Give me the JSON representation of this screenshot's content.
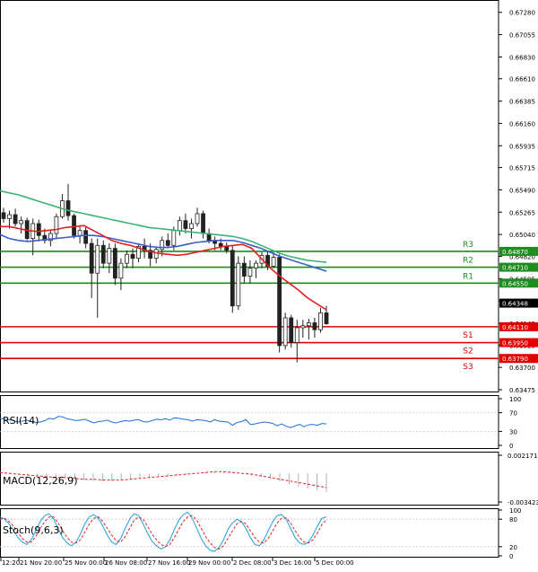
{
  "colors": {
    "bull": "#2e7d32",
    "bear": "#d32f2f",
    "resistance": "#1e8c1e",
    "support": "#e00000",
    "ema_fast": "#e02020",
    "ema_mid": "#3a5fcd",
    "ema_slow": "#3cb371",
    "rsi": "#1e6fd9",
    "macd_hist": "#b0b0b0",
    "macd_signal": "#e02020",
    "stoch_k": "#1ea0e0",
    "stoch_d": "#e02020",
    "current_price_box": "#000000"
  },
  "chart_data": [
    {
      "type": "candlestick",
      "x_labels": [
        "12:20",
        "21 Nov 20:00",
        "25 Nov 00:00",
        "26 Nov 08:00",
        "27 Nov 16:00",
        "29 Nov 00:00",
        "2 Dec 08:00",
        "3 Dec 16:00",
        "5 Dec 00:00"
      ],
      "y_ticks": [
        "0.67280",
        "0.67055",
        "0.66830",
        "0.66610",
        "0.66385",
        "0.66160",
        "0.65935",
        "0.65715",
        "0.65490",
        "0.65265",
        "0.65040",
        "0.64820",
        "0.64595",
        "0.64370",
        "0.64145",
        "0.63925",
        "0.63700",
        "0.63475"
      ],
      "ylim": [
        0.63475,
        0.6735
      ],
      "candles": [
        [
          0.6526,
          0.6531,
          0.6516,
          0.652
        ],
        [
          0.652,
          0.6528,
          0.651,
          0.6524
        ],
        [
          0.6524,
          0.653,
          0.6512,
          0.6515
        ],
        [
          0.6515,
          0.6522,
          0.6505,
          0.6518
        ],
        [
          0.6518,
          0.6521,
          0.6498,
          0.65
        ],
        [
          0.65,
          0.652,
          0.6483,
          0.6515
        ],
        [
          0.6515,
          0.6519,
          0.6497,
          0.6503
        ],
        [
          0.6503,
          0.651,
          0.6495,
          0.6498
        ],
        [
          0.6498,
          0.6508,
          0.6492,
          0.6505
        ],
        [
          0.6505,
          0.6525,
          0.65,
          0.6522
        ],
        [
          0.6522,
          0.6545,
          0.652,
          0.6538
        ],
        [
          0.6538,
          0.6555,
          0.6518,
          0.6523
        ],
        [
          0.6523,
          0.6525,
          0.65,
          0.6503
        ],
        [
          0.6503,
          0.6512,
          0.6495,
          0.6508
        ],
        [
          0.6508,
          0.6512,
          0.649,
          0.6495
        ],
        [
          0.6495,
          0.65,
          0.644,
          0.6465
        ],
        [
          0.6465,
          0.65,
          0.642,
          0.6493
        ],
        [
          0.6493,
          0.6498,
          0.647,
          0.6475
        ],
        [
          0.6475,
          0.6495,
          0.6465,
          0.649
        ],
        [
          0.649,
          0.6495,
          0.6453,
          0.646
        ],
        [
          0.646,
          0.648,
          0.6448,
          0.6475
        ],
        [
          0.6475,
          0.6488,
          0.647,
          0.6484
        ],
        [
          0.6484,
          0.649,
          0.647,
          0.648
        ],
        [
          0.648,
          0.6495,
          0.6476,
          0.6492
        ],
        [
          0.6492,
          0.65,
          0.648,
          0.6488
        ],
        [
          0.6488,
          0.6495,
          0.6472,
          0.648
        ],
        [
          0.648,
          0.6492,
          0.6475,
          0.6489
        ],
        [
          0.6489,
          0.6502,
          0.6482,
          0.6498
        ],
        [
          0.6498,
          0.6505,
          0.649,
          0.6493
        ],
        [
          0.6493,
          0.6512,
          0.6488,
          0.6508
        ],
        [
          0.6508,
          0.6522,
          0.6503,
          0.6518
        ],
        [
          0.6518,
          0.6525,
          0.6505,
          0.651
        ],
        [
          0.651,
          0.652,
          0.65,
          0.6515
        ],
        [
          0.6515,
          0.6531,
          0.6512,
          0.6525
        ],
        [
          0.6525,
          0.6528,
          0.65,
          0.6505
        ],
        [
          0.6505,
          0.651,
          0.6495,
          0.6498
        ],
        [
          0.6498,
          0.6502,
          0.6488,
          0.6495
        ],
        [
          0.6495,
          0.65,
          0.6488,
          0.6492
        ],
        [
          0.6492,
          0.6496,
          0.6485,
          0.6488
        ],
        [
          0.6488,
          0.6493,
          0.6425,
          0.6432
        ],
        [
          0.6432,
          0.6482,
          0.6428,
          0.6475
        ],
        [
          0.6475,
          0.6482,
          0.6455,
          0.6462
        ],
        [
          0.6462,
          0.6478,
          0.6455,
          0.647
        ],
        [
          0.647,
          0.6478,
          0.646,
          0.6475
        ],
        [
          0.6475,
          0.6486,
          0.647,
          0.6483
        ],
        [
          0.6483,
          0.6487,
          0.6468,
          0.6472
        ],
        [
          0.6472,
          0.6486,
          0.647,
          0.6481
        ],
        [
          0.6481,
          0.6484,
          0.6385,
          0.6392
        ],
        [
          0.6392,
          0.6425,
          0.6388,
          0.642
        ],
        [
          0.642,
          0.6423,
          0.639,
          0.6395
        ],
        [
          0.6395,
          0.6418,
          0.6375,
          0.641
        ],
        [
          0.641,
          0.6418,
          0.64,
          0.6412
        ],
        [
          0.6412,
          0.6419,
          0.6398,
          0.6415
        ],
        [
          0.6415,
          0.642,
          0.64,
          0.6408
        ],
        [
          0.6408,
          0.643,
          0.6405,
          0.6425
        ],
        [
          0.6425,
          0.6432,
          0.6413,
          0.6414
        ]
      ],
      "ema_fast": [
        0.6512,
        0.6512,
        0.651,
        0.6508,
        0.6507,
        0.6508,
        0.6509,
        0.6511,
        0.6512,
        0.6513,
        0.6508,
        0.6503,
        0.6498,
        0.6495,
        0.6493,
        0.649,
        0.6487,
        0.6485,
        0.6484,
        0.6483,
        0.6484,
        0.6486,
        0.6488,
        0.649,
        0.6492,
        0.6493,
        0.6494,
        0.649,
        0.648,
        0.647,
        0.6462,
        0.6455,
        0.6448,
        0.644,
        0.6434,
        0.6428
      ],
      "ema_mid": [
        0.6504,
        0.65,
        0.6498,
        0.6497,
        0.6498,
        0.6499,
        0.65,
        0.6501,
        0.6502,
        0.6503,
        0.6503,
        0.6502,
        0.65,
        0.6498,
        0.6496,
        0.6494,
        0.6492,
        0.6491,
        0.6491,
        0.6492,
        0.6494,
        0.6496,
        0.6497,
        0.6498,
        0.6498,
        0.6498,
        0.6496,
        0.6493,
        0.649,
        0.6486,
        0.6482,
        0.6479,
        0.6476,
        0.6473,
        0.647,
        0.6467
      ],
      "ema_slow": [
        0.6548,
        0.6546,
        0.6544,
        0.6541,
        0.6538,
        0.6535,
        0.6532,
        0.6529,
        0.6527,
        0.6525,
        0.6523,
        0.6521,
        0.6519,
        0.6517,
        0.6515,
        0.6513,
        0.6511,
        0.651,
        0.6509,
        0.6508,
        0.6507,
        0.6506,
        0.6505,
        0.6504,
        0.6503,
        0.6502,
        0.65,
        0.6497,
        0.6493,
        0.6489,
        0.6485,
        0.6482,
        0.648,
        0.6478,
        0.6477,
        0.6476
      ],
      "levels": [
        {
          "name": "R3",
          "value": 0.6487,
          "price_label": "0.64870",
          "kind": "resistance"
        },
        {
          "name": "R2",
          "value": 0.6471,
          "price_label": "0.64710",
          "kind": "resistance"
        },
        {
          "name": "R1",
          "value": 0.6455,
          "price_label": "0.64550",
          "kind": "resistance"
        },
        {
          "name": "S1",
          "value": 0.6411,
          "price_label": "0.64110",
          "kind": "support"
        },
        {
          "name": "S2",
          "value": 0.6395,
          "price_label": "0.63950",
          "kind": "support"
        },
        {
          "name": "S3",
          "value": 0.6379,
          "price_label": "0.63790",
          "kind": "support"
        }
      ],
      "current_price": {
        "value": 0.64348,
        "label": "0.64348"
      }
    },
    {
      "type": "line",
      "title": "RSI(14)",
      "y_ticks": [
        "100",
        "70",
        "30",
        "0"
      ],
      "ylim": [
        0,
        100
      ],
      "values": [
        58,
        56,
        55,
        53,
        50,
        52,
        54,
        51,
        49,
        50,
        53,
        58,
        56,
        62,
        61,
        57,
        55,
        53,
        54,
        56,
        52,
        48,
        51,
        52,
        54,
        50,
        48,
        51,
        53,
        52,
        54,
        55,
        51,
        50,
        53,
        56,
        55,
        57,
        54,
        59,
        58,
        56,
        55,
        52,
        55,
        54,
        53,
        50,
        55,
        52,
        51,
        50,
        43,
        49,
        51,
        55,
        45,
        46,
        48,
        50,
        49,
        47,
        42,
        46,
        41,
        38,
        42,
        45,
        40,
        44,
        45,
        43,
        47,
        46
      ]
    },
    {
      "type": "bar",
      "title": "MACD(12,26,9)",
      "y_ticks": [
        "0.002171",
        "-0.003423"
      ],
      "ylim": [
        -0.003423,
        0.002171
      ],
      "histogram": [
        0.0002,
        0.0001,
        -0.0001,
        -0.0002,
        -0.0003,
        -0.0004,
        -0.0005,
        -0.0006,
        -0.0007,
        -0.0008,
        -0.0009,
        -0.001,
        -0.0009,
        -0.0008,
        -0.0007,
        -0.0006,
        -0.0005,
        -0.0004,
        -0.0003,
        -0.0002,
        -0.0001,
        0.0,
        0.0001,
        0.0002,
        0.0002,
        0.0001,
        0.0,
        -0.0002,
        -0.0004,
        -0.0007,
        -0.001,
        -0.0013,
        -0.0016,
        -0.0018,
        -0.002,
        -0.0022
      ],
      "signal": [
        0.0001,
        0.0,
        -0.0001,
        -0.0002,
        -0.0003,
        -0.0004,
        -0.0005,
        -0.0005,
        -0.0006,
        -0.0007,
        -0.0007,
        -0.0008,
        -0.0008,
        -0.0008,
        -0.0007,
        -0.0006,
        -0.0005,
        -0.0004,
        -0.0003,
        -0.0002,
        -0.0001,
        0.0,
        0.0001,
        0.0002,
        0.0002,
        0.0001,
        0.0,
        -0.0001,
        -0.0003,
        -0.0005,
        -0.0007,
        -0.0009,
        -0.0011,
        -0.0013,
        -0.0015,
        -0.0017
      ]
    },
    {
      "type": "line",
      "title": "Stoch(9,6,3)",
      "y_ticks": [
        "100",
        "80",
        "20",
        "0"
      ],
      "ylim": [
        0,
        100
      ],
      "k": [
        85,
        80,
        70,
        55,
        40,
        30,
        25,
        35,
        55,
        75,
        88,
        92,
        80,
        60,
        40,
        28,
        22,
        30,
        48,
        70,
        85,
        90,
        82,
        65,
        45,
        30,
        25,
        38,
        60,
        80,
        92,
        88,
        70,
        50,
        32,
        22,
        15,
        20,
        35,
        58,
        78,
        90,
        95,
        82,
        60,
        38,
        22,
        12,
        10,
        18,
        35,
        58,
        72,
        80,
        75,
        60,
        40,
        25,
        22,
        35,
        55,
        75,
        88,
        90,
        80,
        60,
        40,
        28,
        25,
        30,
        45,
        65,
        82,
        85
      ],
      "d": [
        80,
        82,
        75,
        65,
        50,
        38,
        30,
        30,
        42,
        60,
        75,
        85,
        85,
        72,
        55,
        40,
        30,
        28,
        35,
        52,
        70,
        82,
        85,
        75,
        60,
        45,
        33,
        30,
        42,
        60,
        78,
        85,
        80,
        65,
        48,
        35,
        25,
        20,
        25,
        40,
        58,
        75,
        85,
        88,
        78,
        60,
        42,
        28,
        18,
        15,
        22,
        38,
        55,
        70,
        75,
        70,
        55,
        40,
        30,
        28,
        38,
        55,
        72,
        82,
        83,
        72,
        55,
        40,
        30,
        28,
        35,
        50,
        68,
        78
      ]
    }
  ]
}
